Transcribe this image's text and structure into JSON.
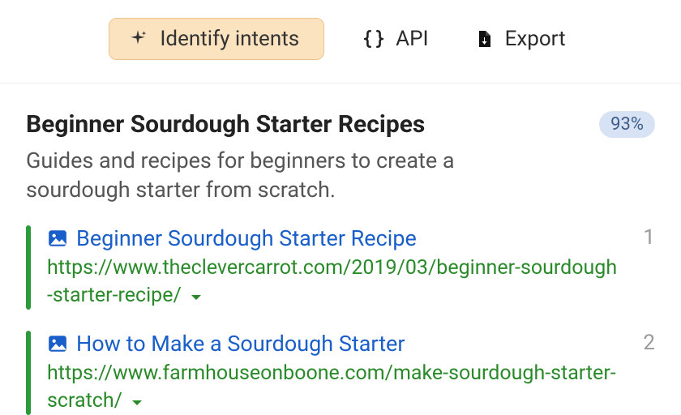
{
  "toolbar": {
    "identify_label": "Identify intents",
    "api_label": "API",
    "export_label": "Export"
  },
  "topic": {
    "title": "Beginner Sourdough Starter Recipes",
    "description": "Guides and recipes for beginners to create a sourdough starter from scratch.",
    "confidence": "93%"
  },
  "results": [
    {
      "rank": "1",
      "title": "Beginner Sourdough Starter Recipe",
      "url": "https://www.theclevercarrot.com/2019/03/beginner-sourdough-starter-recipe/"
    },
    {
      "rank": "2",
      "title": "How to Make a Sourdough Starter",
      "url": "https://www.farmhouseonboone.com/make-sourdough-starter-scratch/"
    }
  ]
}
